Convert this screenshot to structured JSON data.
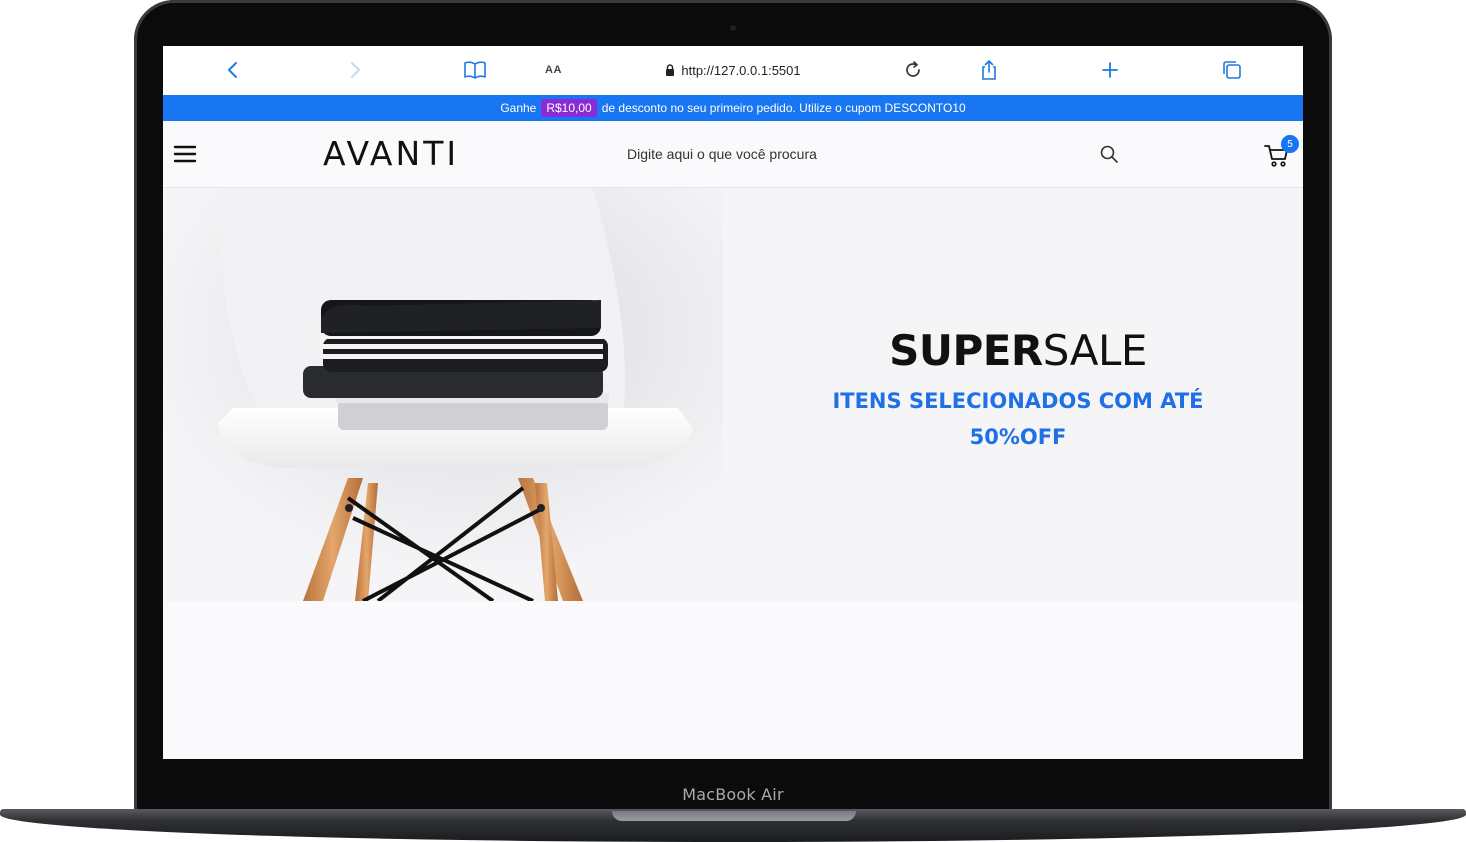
{
  "device": {
    "model_label": "MacBook Air"
  },
  "browser": {
    "reader_label": "AA",
    "url": "http://127.0.0.1:5501",
    "icons": [
      "chevron-left-icon",
      "chevron-right-icon",
      "book-icon",
      "lock-icon",
      "reload-icon",
      "share-icon",
      "plus-icon",
      "tabs-icon"
    ]
  },
  "promo": {
    "prefix": "Ganhe",
    "amount": "R$10,00",
    "suffix": "de desconto no seu primeiro pedido. Utilize o cupom DESCONTO10"
  },
  "header": {
    "logo": "AVANTI",
    "search_placeholder": "Digite aqui o que você procura",
    "cart_count": "5"
  },
  "hero": {
    "title_bold": "SUPER",
    "title_light": "SALE",
    "subtitle_line1": "ITENS SELECIONADOS COM ATÉ",
    "subtitle_line2": "50%OFF"
  },
  "colors": {
    "accent": "#1976f2",
    "promo_badge": "#8a2bd6",
    "hero_subtitle": "#1f6fe6"
  }
}
